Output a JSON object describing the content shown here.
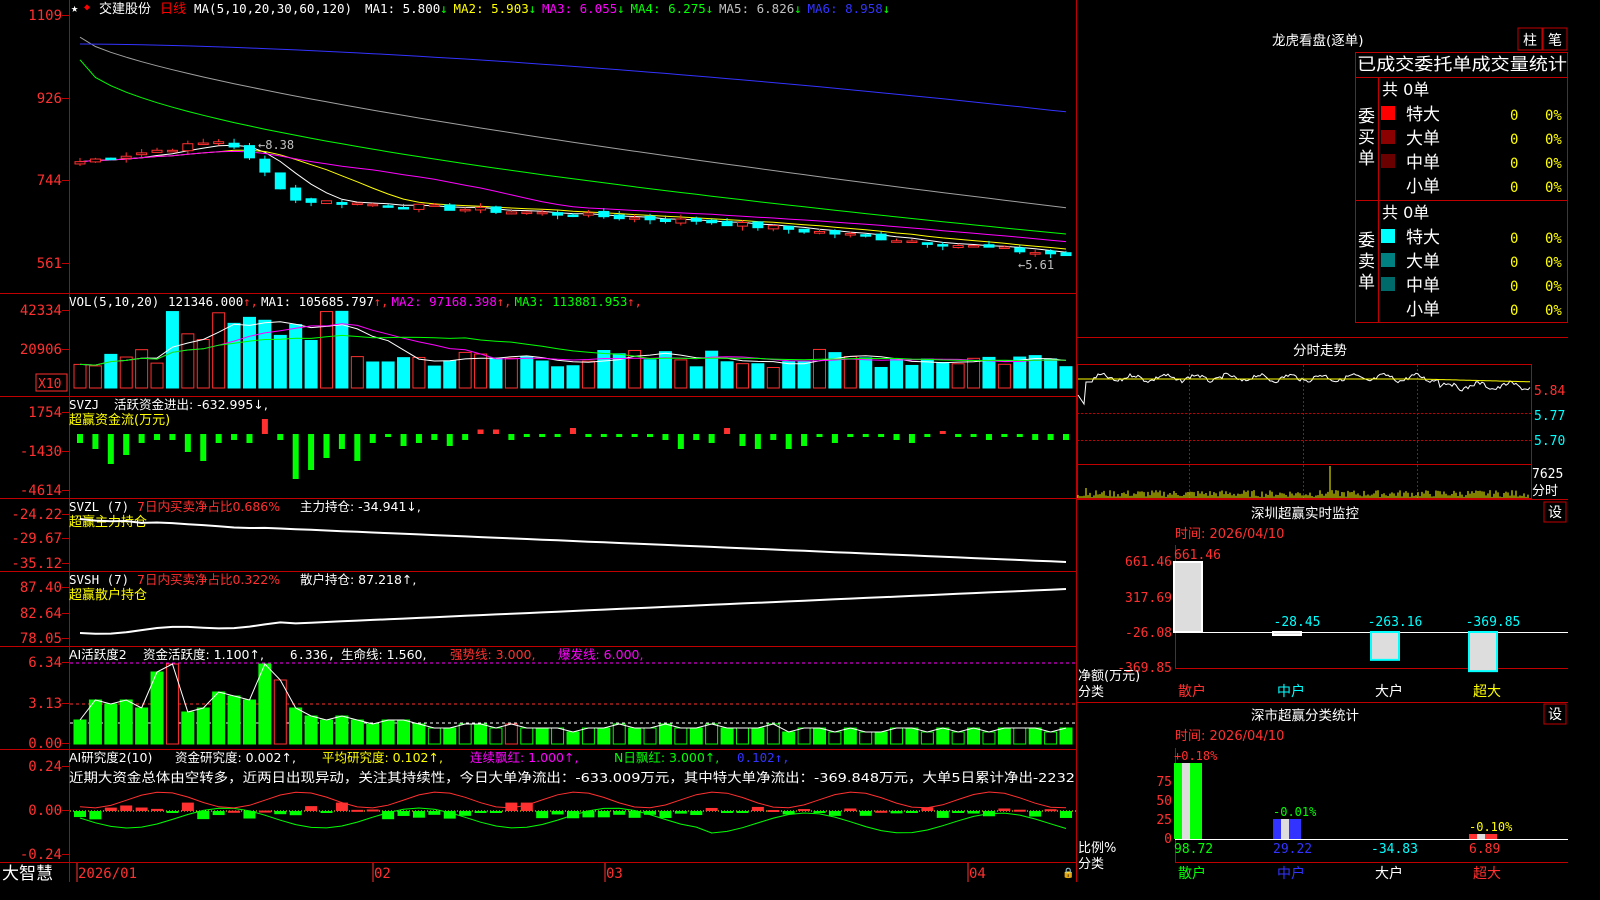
{
  "stock": {
    "name": "交建股份",
    "period": "日线",
    "bottom_brand": "大智慧"
  },
  "price_panel": {
    "ma_header": "MA(5,10,20,30,60,120)",
    "ma_values": [
      {
        "label": "MA1:",
        "value": "5.800",
        "arrow": "↓",
        "color": "#ffffff"
      },
      {
        "label": "MA2:",
        "value": "5.903",
        "arrow": "↓",
        "color": "#ffff00"
      },
      {
        "label": "MA3:",
        "value": "6.055",
        "arrow": "↓",
        "color": "#ff00ff"
      },
      {
        "label": "MA4:",
        "value": "6.275",
        "arrow": "↓",
        "color": "#00ff00"
      },
      {
        "label": "MA5:",
        "value": "6.826",
        "arrow": "↓",
        "color": "#c0c0c0"
      },
      {
        "label": "MA6:",
        "value": "8.958",
        "arrow": "↓",
        "color": "#3333ff"
      }
    ],
    "y_ticks": [
      "1109",
      "926",
      "744",
      "561"
    ],
    "high_label": "8.38",
    "low_label": "5.61"
  },
  "vol_panel": {
    "header": "VOL(5,10,20)",
    "items": [
      {
        "text": "121346.000",
        "arrow": "↑",
        "color": "#ffffff"
      },
      {
        "text": "MA1: 105685.797",
        "arrow": "↑",
        "color": "#ffffff"
      },
      {
        "text": "MA2: 97168.398",
        "arrow": "↑",
        "color": "#ff00ff"
      },
      {
        "text": "MA3: 113881.953",
        "arrow": "↑",
        "color": "#00ff00"
      }
    ],
    "y_ticks": [
      "42334",
      "20906"
    ],
    "unit_label": "X10"
  },
  "svzj_panel": {
    "header": "SVZJ",
    "line1": "活跃资金进出: -632.995↓,",
    "line2": "超赢资金流(万元)",
    "y_ticks": [
      "1754",
      "-1430",
      "-4614"
    ]
  },
  "svzl_panel": {
    "header": "SVZL (7)",
    "text_red": "7日内买卖净占比0.686%",
    "text_white": "主力持仓: -34.941↓,",
    "line2": "超赢主力持仓",
    "y_ticks": [
      "-24.22",
      "-29.67",
      "-35.12"
    ]
  },
  "svsh_panel": {
    "header": "SVSH (7)",
    "text_red": "7日内买卖净占比0.322%",
    "text_white": "散户持仓: 87.218↑,",
    "line2": "超赢散户持仓",
    "y_ticks": [
      "87.40",
      "82.64",
      "78.05"
    ]
  },
  "ai_active_panel": {
    "header": "AI活跃度2",
    "text1": "资金活跃度: 1.100↑,",
    "text2": "6.336,",
    "text3": "生命线: 1.560,",
    "text4": "强势线: 3.000,",
    "text5": "爆发线: 6.000,",
    "y_ticks": [
      "6.34",
      "3.13",
      "0.00"
    ]
  },
  "ai_research_panel": {
    "header": "AI研究度2(10)",
    "text1": "资金研究度: 0.002↑,",
    "text2": "平均研究度: 0.102↑,",
    "text3": "连续飘红: 1.000↑,",
    "text4": "N日飘红: 3.000↑,",
    "text5": "0.102↑,",
    "commentary": "近期大资金总体由空转多，近两日出现异动，关注其持续性，今日大单净流出：-633.009万元，其中特大单净流出：-369.848万元，大单5日累计净出-2232",
    "y_ticks": [
      "0.24",
      "0.00",
      "-0.24"
    ]
  },
  "x_axis": [
    "2026/01",
    "02",
    "03",
    "04"
  ],
  "dragon_tiger": {
    "title": "龙虎看盘(逐单)",
    "btn_col": "柱",
    "btn_stroke": "笔",
    "subtitle": "已成交委托单成交量统计",
    "buy_label": "委买单",
    "sell_label": "委卖单",
    "buy_total": "共 0单",
    "sell_total": "共 0单",
    "buy_rows": [
      {
        "name": "特大",
        "count": "0",
        "pct": "0%",
        "color": "#ff0000"
      },
      {
        "name": "大单",
        "count": "0",
        "pct": "0%",
        "color": "#8b0000"
      },
      {
        "name": "中单",
        "count": "0",
        "pct": "0%",
        "color": "#6b0000"
      },
      {
        "name": "小单",
        "count": "0",
        "pct": "0%",
        "color": ""
      }
    ],
    "sell_rows": [
      {
        "name": "特大",
        "count": "0",
        "pct": "0%",
        "color": "#00ffff"
      },
      {
        "name": "大单",
        "count": "0",
        "pct": "0%",
        "color": "#008080"
      },
      {
        "name": "中单",
        "count": "0",
        "pct": "0%",
        "color": "#006a6a"
      },
      {
        "name": "小单",
        "count": "0",
        "pct": "0%",
        "color": ""
      }
    ]
  },
  "intraday": {
    "title": "分时走势",
    "y_ticks": [
      "5.84",
      "5.77",
      "5.70"
    ],
    "vol_tick": "7625",
    "vol_label": "分时"
  },
  "sz_monitor": {
    "title": "深圳超赢实时监控",
    "set_btn": "设",
    "time": "时间: 2026/04/10",
    "y_ticks": [
      "661.46",
      "317.69",
      "-26.08",
      "-369.85"
    ],
    "unit": "净额(万元)",
    "cat_label": "分类",
    "categories": [
      "散户",
      "中户",
      "大户",
      "超大"
    ],
    "values": [
      "661.46",
      "-28.45",
      "-263.16",
      "-369.85"
    ]
  },
  "sz_class": {
    "title": "深市超赢分类统计",
    "set_btn": "设",
    "time": "时间: 2026/04/10",
    "y_ticks": [
      "75",
      "50",
      "25",
      "0"
    ],
    "unit": "比例%",
    "cat_label": "分类",
    "categories": [
      "散户",
      "中户",
      "大户",
      "超大"
    ],
    "pct_top": [
      "+0.18%",
      "-0.01%",
      "",
      "-0.10%"
    ],
    "values": [
      "98.72",
      "29.22",
      "-34.83",
      "6.89"
    ]
  },
  "chart_data": {
    "type": "candlestick",
    "title": "交建股份 日线",
    "x_labels": [
      "2026/01",
      "02",
      "03",
      "04"
    ],
    "price_range": [
      5.61,
      11.09
    ],
    "high": 8.38,
    "low": 5.61,
    "last_ma": {
      "MA5": 5.8,
      "MA10": 5.903,
      "MA20": 6.055,
      "MA30": 6.275,
      "MA60": 6.826,
      "MA120": 8.958
    },
    "last_volume": 121346.0,
    "sz_monitor_values": {
      "散户": 661.46,
      "中户": -28.45,
      "大户": -263.16,
      "超大": -369.85
    },
    "sz_class_values": {
      "散户": 98.72,
      "中户": 29.22,
      "大户": -34.83,
      "超大": 6.89
    }
  }
}
